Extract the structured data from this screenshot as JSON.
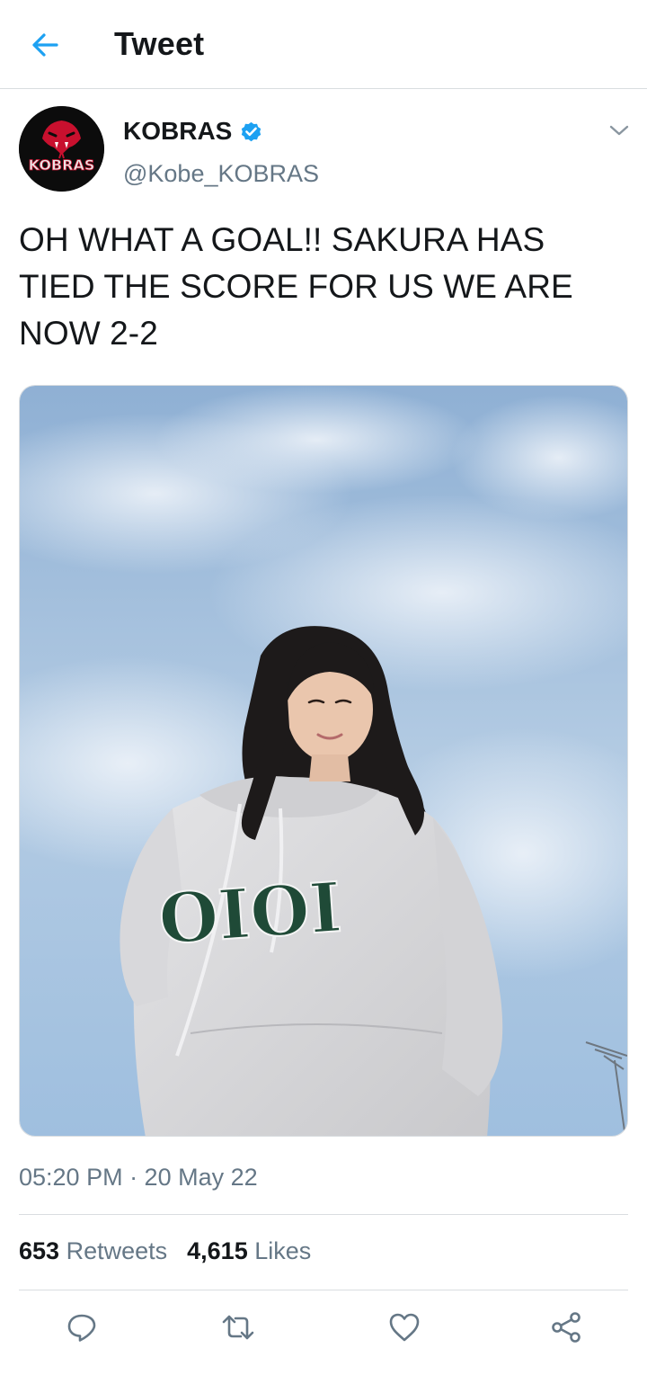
{
  "header": {
    "title": "Tweet",
    "back_icon": "arrow-left-icon",
    "accent": "#1da1f2"
  },
  "tweet": {
    "author": {
      "name": "KOBRAS",
      "handle": "@Kobe_KOBRAS",
      "verified": true,
      "avatar_text": "KOBRAS",
      "avatar_bg": "#0c0c0c",
      "avatar_accent": "#c8102e"
    },
    "text": "OH WHAT A GOAL!! SAKURA HAS TIED THE SCORE FOR US WE ARE NOW 2-2",
    "media": {
      "sweatshirt_text": "OIOI"
    },
    "timestamp": "05:20 PM · 20 May 22",
    "stats": {
      "retweets_count": "653",
      "retweets_label": "Retweets",
      "likes_count": "4,615",
      "likes_label": "Likes"
    },
    "actions": [
      "reply-icon",
      "retweet-icon",
      "like-icon",
      "share-icon"
    ]
  },
  "colors": {
    "text_primary": "#14171a",
    "text_secondary": "#657786",
    "divider": "#d9dde0",
    "verified": "#1da1f2"
  }
}
